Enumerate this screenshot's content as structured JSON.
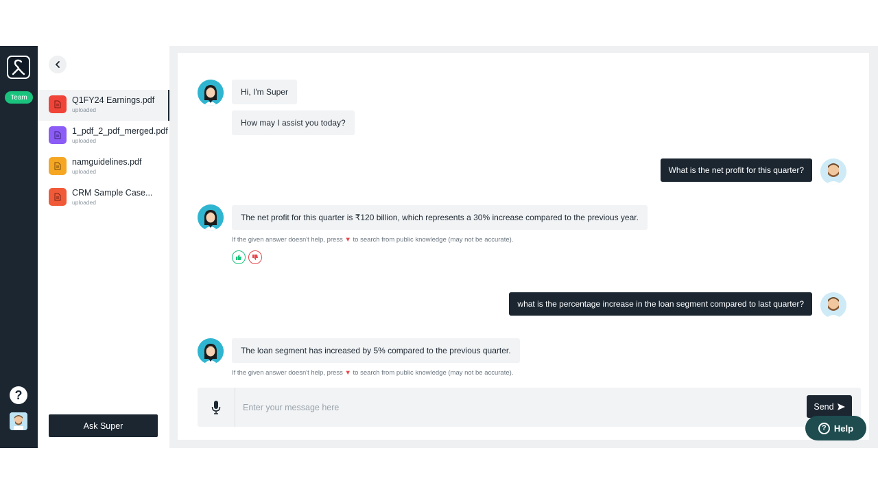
{
  "rail": {
    "team_label": "Team",
    "help_icon": "?"
  },
  "sidebar": {
    "files": [
      {
        "name": "Q1FY24 Earnings.pdf",
        "status": "uploaded",
        "color": "#f04438"
      },
      {
        "name": "1_pdf_2_pdf_merged.pdf",
        "status": "uploaded",
        "color": "#8b5cf6"
      },
      {
        "name": "namguidelines.pdf",
        "status": "uploaded",
        "color": "#f5a623"
      },
      {
        "name": "CRM Sample Case...",
        "status": "uploaded",
        "color": "#f05a38"
      }
    ],
    "ask_label": "Ask Super"
  },
  "chat": {
    "greeting": "Hi, I'm Super",
    "assist": "How may I assist you today?",
    "q1": "What is the net profit for this quarter?",
    "a1": "The net profit for this quarter is ₹120 billion, which represents a 30% increase compared to the previous year.",
    "note_before": "If the given answer doesn't help, press",
    "note_after": "to search from public knowledge (may not be accurate).",
    "q2": "what is the percentage increase in the loan segment compared to last quarter?",
    "a2": "The loan segment has increased by 5% compared to the previous quarter."
  },
  "composer": {
    "placeholder": "Enter your message here",
    "send_label": "Send"
  },
  "help_fab": {
    "label": "Help"
  },
  "colors": {
    "dark": "#1b2631",
    "accent_green": "#19c37d",
    "thumbs_down_red": "#e5484d"
  }
}
